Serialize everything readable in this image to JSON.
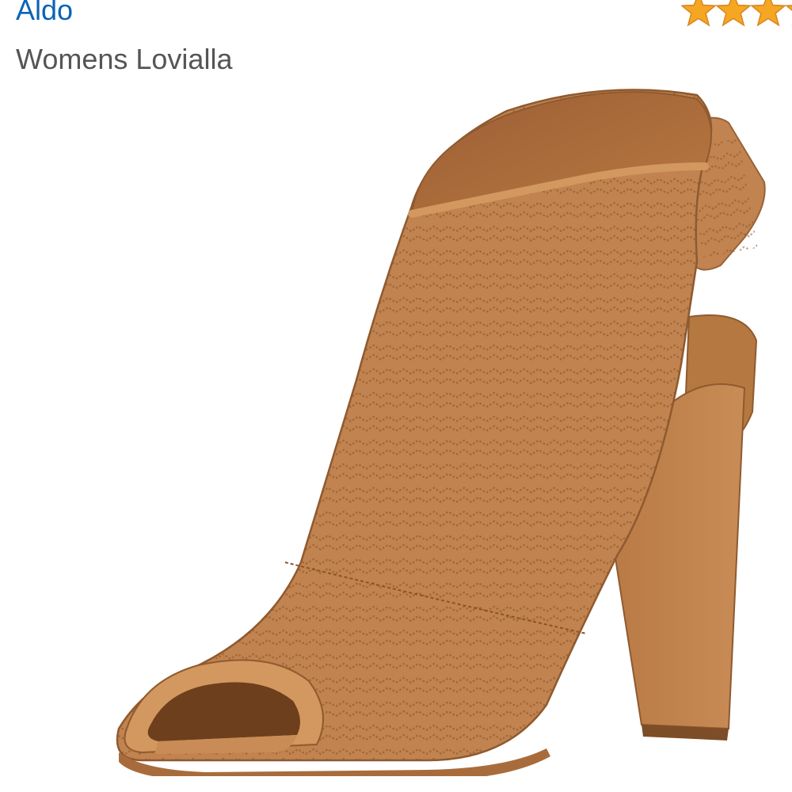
{
  "product": {
    "brand": "Aldo",
    "name": "Womens Lovialla"
  },
  "rating": {
    "stars_visible": 3.5,
    "star_color": "#f5a623",
    "star_outline": "#d9861c"
  },
  "image": {
    "icon": "product-photo-shoe",
    "shoe_color": "#c1834f",
    "shoe_shade": "#a86c3c",
    "shoe_light": "#d3985f"
  }
}
